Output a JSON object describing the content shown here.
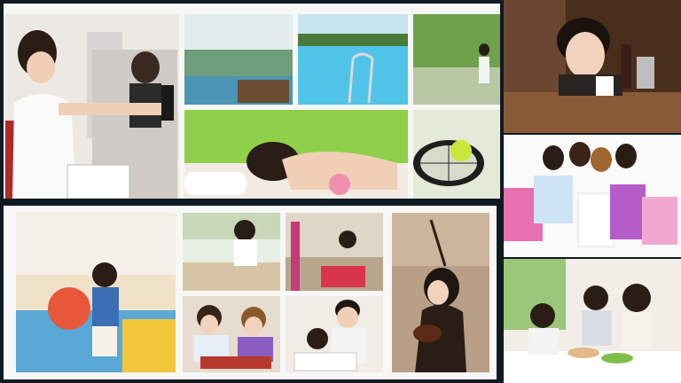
{
  "image": {
    "kind": "photo collage",
    "colors": {
      "frame": "#0f1a22",
      "panel": "#f7f7f5",
      "pool_water": "#4fc3e8",
      "lawn": "#7fbf4a",
      "bags_pink": "#e86fb0",
      "warm_wood": "#8a5a36"
    },
    "tiles": [
      {
        "name": "gym-photo"
      },
      {
        "name": "indoor-pool-photo"
      },
      {
        "name": "outdoor-pool-photo"
      },
      {
        "name": "park-runner-photo"
      },
      {
        "name": "spa-massage-photo"
      },
      {
        "name": "tennis-photo"
      },
      {
        "name": "cafe-woman-photo"
      },
      {
        "name": "shopping-women-photo"
      },
      {
        "name": "kids-playroom-photo"
      },
      {
        "name": "kids-crafts-photo"
      },
      {
        "name": "playground-photo"
      },
      {
        "name": "kids-reading-photo"
      },
      {
        "name": "father-daughter-photo"
      },
      {
        "name": "violin-girl-photo"
      },
      {
        "name": "family-dinner-photo"
      }
    ]
  }
}
